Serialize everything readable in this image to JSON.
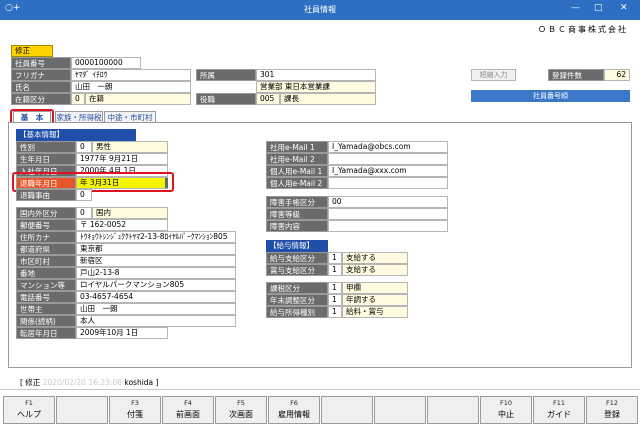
{
  "window": {
    "title": "社員情報",
    "app_icon": "○+",
    "minimize": "—",
    "maximize": "□",
    "close": "✕"
  },
  "company": "ＯＢＣ商事株式会社",
  "mode_tag": "修正",
  "header": {
    "employee_no_label": "社員番号",
    "employee_no": "0000100000",
    "furigana_label": "フリガナ",
    "furigana": "ﾔﾏﾀﾞ ｲﾁﾛｳ",
    "name_label": "氏名",
    "name": "山田　一朗",
    "status_label": "在籍区分",
    "status_code": "0",
    "status": "在籍",
    "dept_label": "所属",
    "dept_code": "301",
    "dept_name": "営業部 東日本営業課",
    "title_label": "役職",
    "title_code": "005",
    "title_name": "課長",
    "short_input": "短縮入力",
    "reg_count_label": "登録件数",
    "reg_count": "62",
    "employee_no_order": "社員番号順"
  },
  "tabs": [
    "基　本",
    "家族・所得税",
    "中途・市町村"
  ],
  "basic": {
    "section": "【基本情報】",
    "gender_label": "性別",
    "gender_code": "0",
    "gender": "男性",
    "birth_label": "生年月日",
    "birth": "1977年  9月21日",
    "join_label": "入社年月日",
    "join": "2000年  4月  1日",
    "retire_label": "退職年月日",
    "retire": "年  3月31日",
    "retire_reason_label": "退職事由",
    "retire_reason_code": "0",
    "country_label": "国内外区分",
    "country_code": "0",
    "country": "国内",
    "zip_label": "郵便番号",
    "zip": "〒  162-0052",
    "address_kana_label": "住所カナ",
    "address_kana": "ﾄｳｷｮｳﾄｼﾝｼﾞｭｸｸﾄﾔﾏ2-13-8ﾛｲﾔﾙﾊﾟｰｸﾏﾝｼｮﾝ805",
    "pref_label": "都道府県",
    "pref": "東京都",
    "city_label": "市区町村",
    "city": "新宿区",
    "block_label": "番地",
    "block": "戸山2-13-8",
    "mansion_label": "マンション等",
    "mansion": "ロイヤルパークマンション805",
    "phone_label": "電話番号",
    "phone": "03-4657-4654",
    "householder_label": "世帯主",
    "householder": "山田　一朗",
    "relation_label": "関係(続柄)",
    "relation": "本人",
    "moved_label": "転居年月日",
    "moved": "2009年10月  1日"
  },
  "contact": {
    "company_mail1_label": "社用e-Mail 1",
    "company_mail1": "I_Yamada@obcs.com",
    "company_mail2_label": "社用e-Mail 2",
    "personal_mail1_label": "個人用e-Mail 1",
    "personal_mail1": "I_Yamada@xxx.com",
    "personal_mail2_label": "個人用e-Mail 2",
    "disab_label": "障害手帳区分",
    "disab_code": "00",
    "disab_grade_label": "障害等級",
    "disab_detail_label": "障害内容"
  },
  "pay": {
    "section": "【給与情報】",
    "salary_label": "給与支給区分",
    "salary_code": "1",
    "salary": "支給する",
    "bonus_label": "賞与支給区分",
    "bonus_code": "1",
    "bonus": "支給する",
    "tax_label": "課税区分",
    "tax_code": "1",
    "tax": "甲欄",
    "adj_label": "年末調整区分",
    "adj_code": "1",
    "adj": "年調する",
    "income_label": "給与所得種別",
    "income_code": "1",
    "income": "給料・賞与"
  },
  "status_line": {
    "label": "[ 修正",
    "timestamp": "2020/02/20 16:23:08",
    "user": "koshida"
  },
  "fkeys": [
    {
      "n": "F1",
      "l": "ヘルプ"
    },
    {
      "n": "",
      "l": ""
    },
    {
      "n": "F3",
      "l": "付箋"
    },
    {
      "n": "F4",
      "l": "前画面"
    },
    {
      "n": "F5",
      "l": "次画面"
    },
    {
      "n": "F6",
      "l": "雇用情報"
    },
    {
      "n": "",
      "l": ""
    },
    {
      "n": "",
      "l": ""
    },
    {
      "n": "",
      "l": ""
    },
    {
      "n": "F10",
      "l": "中止"
    },
    {
      "n": "F11",
      "l": "ガイド"
    },
    {
      "n": "F12",
      "l": "登録"
    }
  ]
}
